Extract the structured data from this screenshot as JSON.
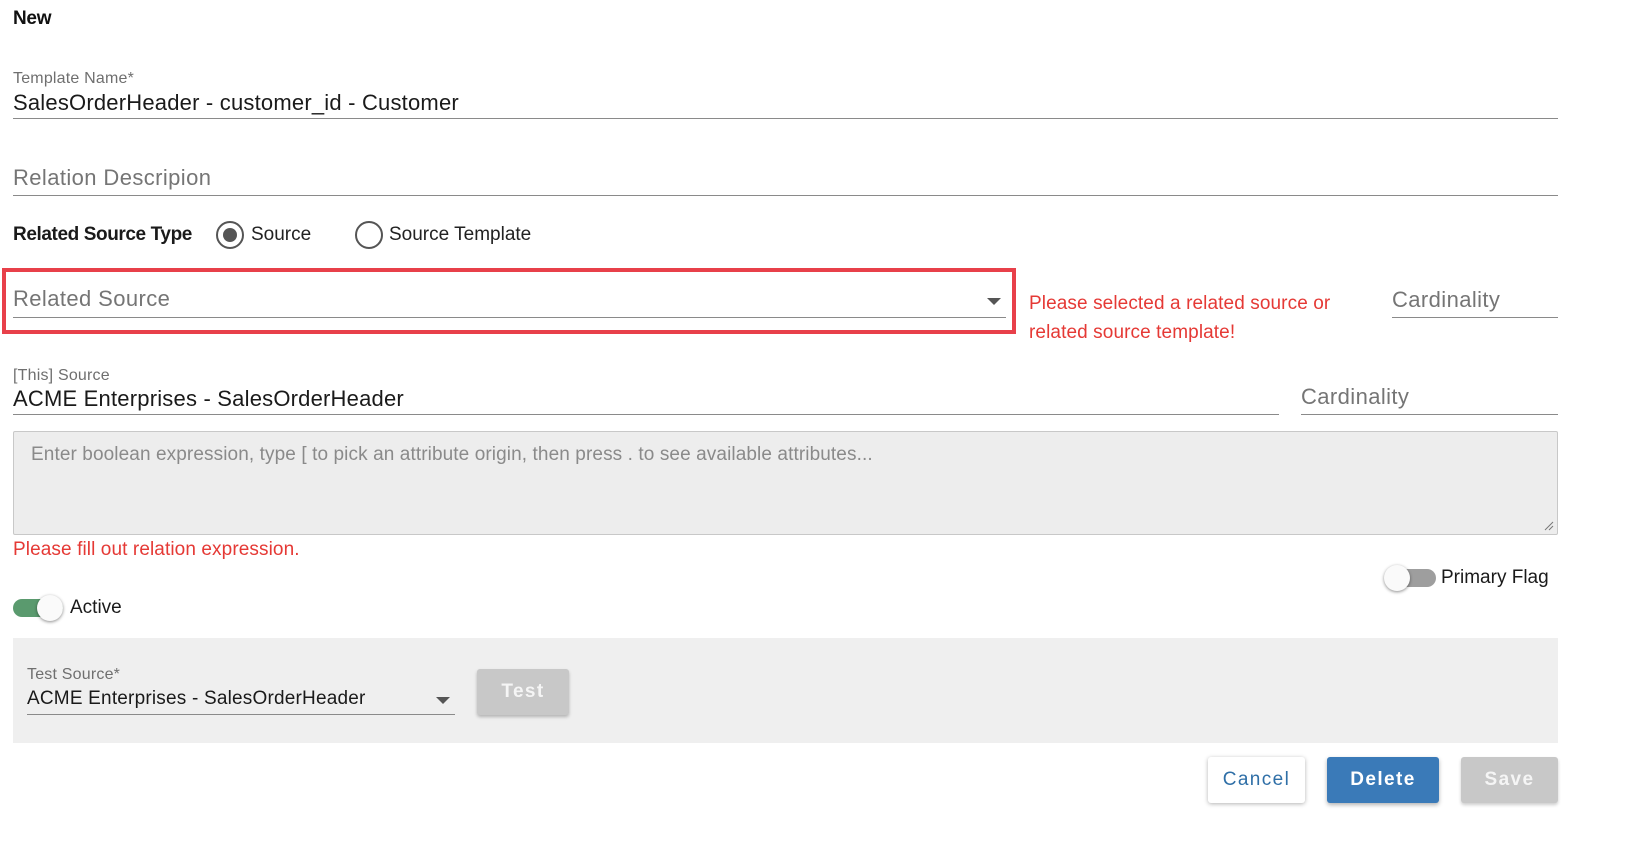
{
  "form": {
    "title": "New"
  },
  "template_name": {
    "label": "Template Name*",
    "value": "SalesOrderHeader - customer_id - Customer"
  },
  "relation_description": {
    "placeholder": "Relation Descripion"
  },
  "related_source_type": {
    "label": "Related Source Type",
    "options": [
      {
        "label": "Source",
        "selected": true
      },
      {
        "label": "Source Template",
        "selected": false
      }
    ]
  },
  "related_source": {
    "placeholder": "Related Source",
    "error_line1": "Please selected a related source or",
    "error_line2": "related source template!",
    "cardinality_placeholder": "Cardinality",
    "highlight_color": "#e8404a"
  },
  "this_source": {
    "label": "[This] Source",
    "value": "ACME Enterprises - SalesOrderHeader",
    "cardinality_placeholder": "Cardinality"
  },
  "expression": {
    "placeholder": "Enter boolean expression, type [ to pick an attribute origin, then press . to see available attributes...",
    "error": "Please fill out relation expression."
  },
  "primary_flag": {
    "label": "Primary Flag",
    "on": false
  },
  "active": {
    "label": "Active",
    "on": true,
    "accent": "#5a9a6e"
  },
  "test_panel": {
    "label": "Test Source*",
    "value": "ACME Enterprises - SalesOrderHeader",
    "test_label": "Test"
  },
  "actions": {
    "cancel_label": "Cancel",
    "delete_label": "Delete",
    "save_label": "Save"
  },
  "colors": {
    "error": "#e53935",
    "primary": "#3a7ab8"
  }
}
